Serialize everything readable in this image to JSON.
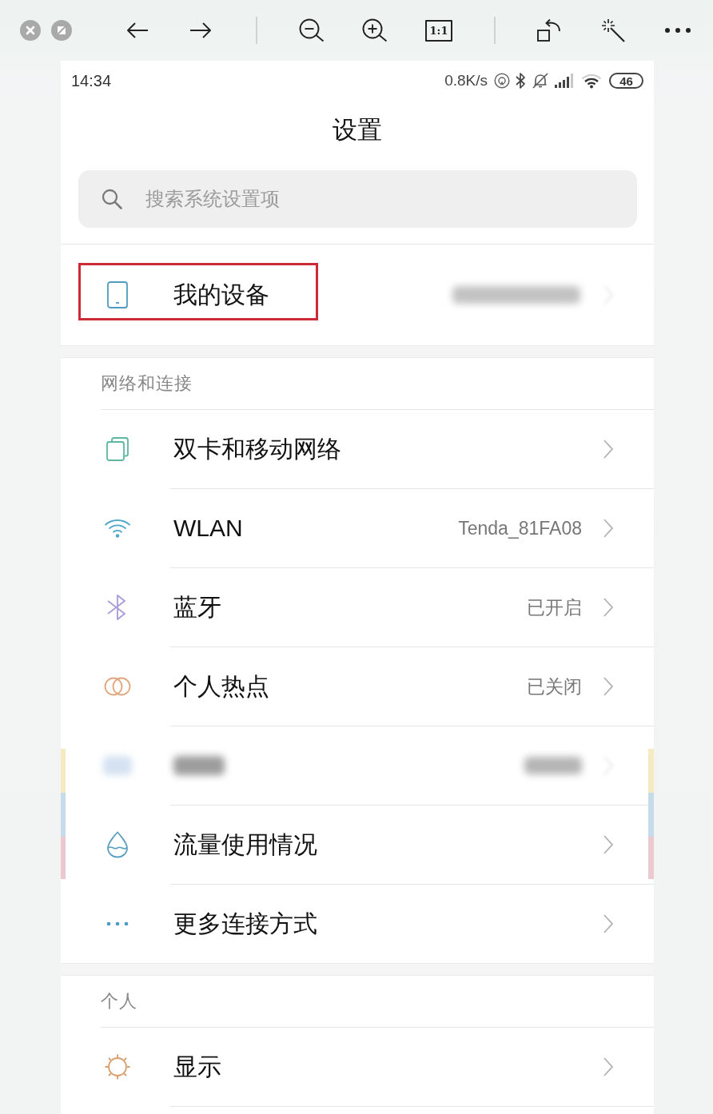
{
  "toolbar": {
    "actual_size": "1:1"
  },
  "status_bar": {
    "time": "14:34",
    "network_speed": "0.8K/s",
    "battery": "46"
  },
  "title": "设置",
  "search": {
    "placeholder": "搜索系统设置项"
  },
  "device_row": {
    "label": "我的设备",
    "highlighted": true,
    "value_blurred": true
  },
  "sections": [
    {
      "header": "网络和连接",
      "items": [
        {
          "kind": "link",
          "label": "双卡和移动网络"
        },
        {
          "kind": "link",
          "label": "WLAN",
          "value": "Tenda_81FA08"
        },
        {
          "kind": "link",
          "label": "蓝牙",
          "value": "已开启"
        },
        {
          "kind": "link",
          "label": "个人热点",
          "value": "已关闭"
        },
        {
          "kind": "blurred"
        },
        {
          "kind": "link",
          "label": "流量使用情况"
        },
        {
          "kind": "link",
          "label": "更多连接方式"
        }
      ]
    },
    {
      "header": "个人",
      "items": [
        {
          "kind": "link",
          "label": "显示"
        }
      ]
    }
  ]
}
